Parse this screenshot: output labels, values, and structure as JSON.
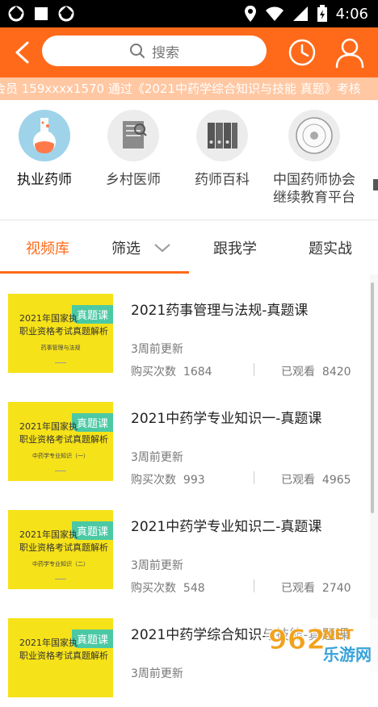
{
  "status_bar": {
    "time": "4:06"
  },
  "header": {
    "search_placeholder": "搜索"
  },
  "marquee": {
    "text": "会员 159xxxx1570 通过《2021中药学综合知识与技能 真题》考核"
  },
  "categories": [
    {
      "label": "执业药师",
      "icon": "flask-icon"
    },
    {
      "label": "乡村医师",
      "icon": "document-magnifier-icon"
    },
    {
      "label": "药师百科",
      "icon": "binders-icon"
    },
    {
      "label": "中国药师协会\n继续教育平台",
      "icon": "association-seal-icon"
    }
  ],
  "tabs": {
    "video": "视频库",
    "filter": "筛选",
    "follow": "跟我学",
    "practice": "题实战"
  },
  "thumbnail": {
    "line1": "2021年国家执",
    "line2": "职业资格考试真题解析",
    "tag": "真题课",
    "subtitles": [
      "药事管理与法规",
      "中药学专业知识（一）",
      "中药学专业知识（二）",
      ""
    ]
  },
  "courses": [
    {
      "title": "2021药事管理与法规-真题课",
      "update": "3周前更新",
      "buy_label": "购买次数",
      "buy_count": "1684",
      "seen_label": "已观看",
      "seen_count": "8420"
    },
    {
      "title": "2021中药学专业知识一-真题课",
      "update": "3周前更新",
      "buy_label": "购买次数",
      "buy_count": "993",
      "seen_label": "已观看",
      "seen_count": "4965"
    },
    {
      "title": "2021中药学专业知识二-真题课",
      "update": "3周前更新",
      "buy_label": "购买次数",
      "buy_count": "548",
      "seen_label": "已观看",
      "seen_count": "2740"
    },
    {
      "title": "2021中药学综合知识与技能-真题课",
      "update": "3周前更新",
      "buy_label": "",
      "buy_count": "",
      "seen_label": "",
      "seen_count": ""
    }
  ],
  "watermark": {
    "brand": "962",
    "suffix": "NET",
    "cn": "乐游网"
  },
  "colors": {
    "accent": "#ff6a1a",
    "thumb_yellow": "#f6e219",
    "tag_green": "#4bc9a4"
  }
}
